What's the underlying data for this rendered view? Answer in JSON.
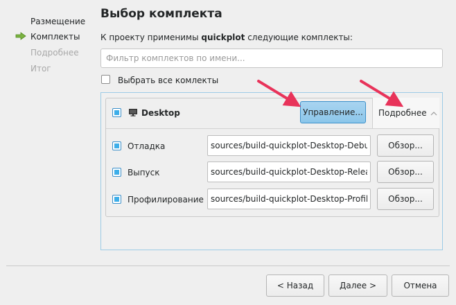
{
  "wizard": {
    "steps": [
      {
        "label": "Размещение",
        "state": "done"
      },
      {
        "label": "Комплекты",
        "state": "current"
      },
      {
        "label": "Подробнее",
        "state": "pending"
      },
      {
        "label": "Итог",
        "state": "pending"
      }
    ],
    "current_step_icon": "green-arrow-icon"
  },
  "page": {
    "title": "Выбор комплекта",
    "description_prefix": "К проекту применимы ",
    "project_name": "quickplot",
    "description_suffix": " следующие комплекты:"
  },
  "filter": {
    "placeholder": "Фильтр комплектов по имени...",
    "value": ""
  },
  "select_all": {
    "label": "Выбрать все комлекты",
    "checked": false
  },
  "kit": {
    "name": "Desktop",
    "icon": "monitor-icon",
    "checked": "partial",
    "manage_label": "Управление...",
    "details_label": "Подробнее",
    "builds": [
      {
        "label": "Отладка",
        "checked": true,
        "path": "sources/build-quickplot-Desktop-Debug",
        "browse_label": "Обзор..."
      },
      {
        "label": "Выпуск",
        "checked": true,
        "path": "sources/build-quickplot-Desktop-Release",
        "browse_label": "Обзор..."
      },
      {
        "label": "Профилирование",
        "checked": true,
        "path": "sources/build-quickplot-Desktop-Profile",
        "browse_label": "Обзор..."
      }
    ]
  },
  "footer": {
    "back_label": "< Назад",
    "next_label": "Далее >",
    "cancel_label": "Отмена"
  },
  "colors": {
    "accent": "#3daee9",
    "annotation_arrow": "#e8335a",
    "step_arrow": "#7cb342"
  }
}
